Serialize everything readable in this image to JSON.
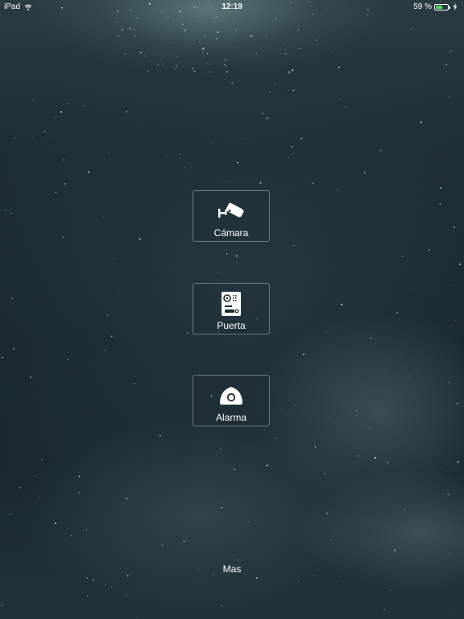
{
  "status_bar": {
    "device": "iPad",
    "time": "12:19",
    "battery_percent": "59 %",
    "battery_level": 0.59,
    "wifi_icon": "wifi-icon",
    "charging_icon": "charging-bolt-icon"
  },
  "menu": {
    "items": [
      {
        "label": "Cámara",
        "icon": "security-camera-icon"
      },
      {
        "label": "Puerta",
        "icon": "door-intercom-icon"
      },
      {
        "label": "Alarma",
        "icon": "alarm-sensor-icon"
      }
    ],
    "more_label": "Mas"
  },
  "colors": {
    "text": "#ffffff",
    "battery_fill": "#4cd964",
    "tile_border": "#c8d2d7"
  }
}
